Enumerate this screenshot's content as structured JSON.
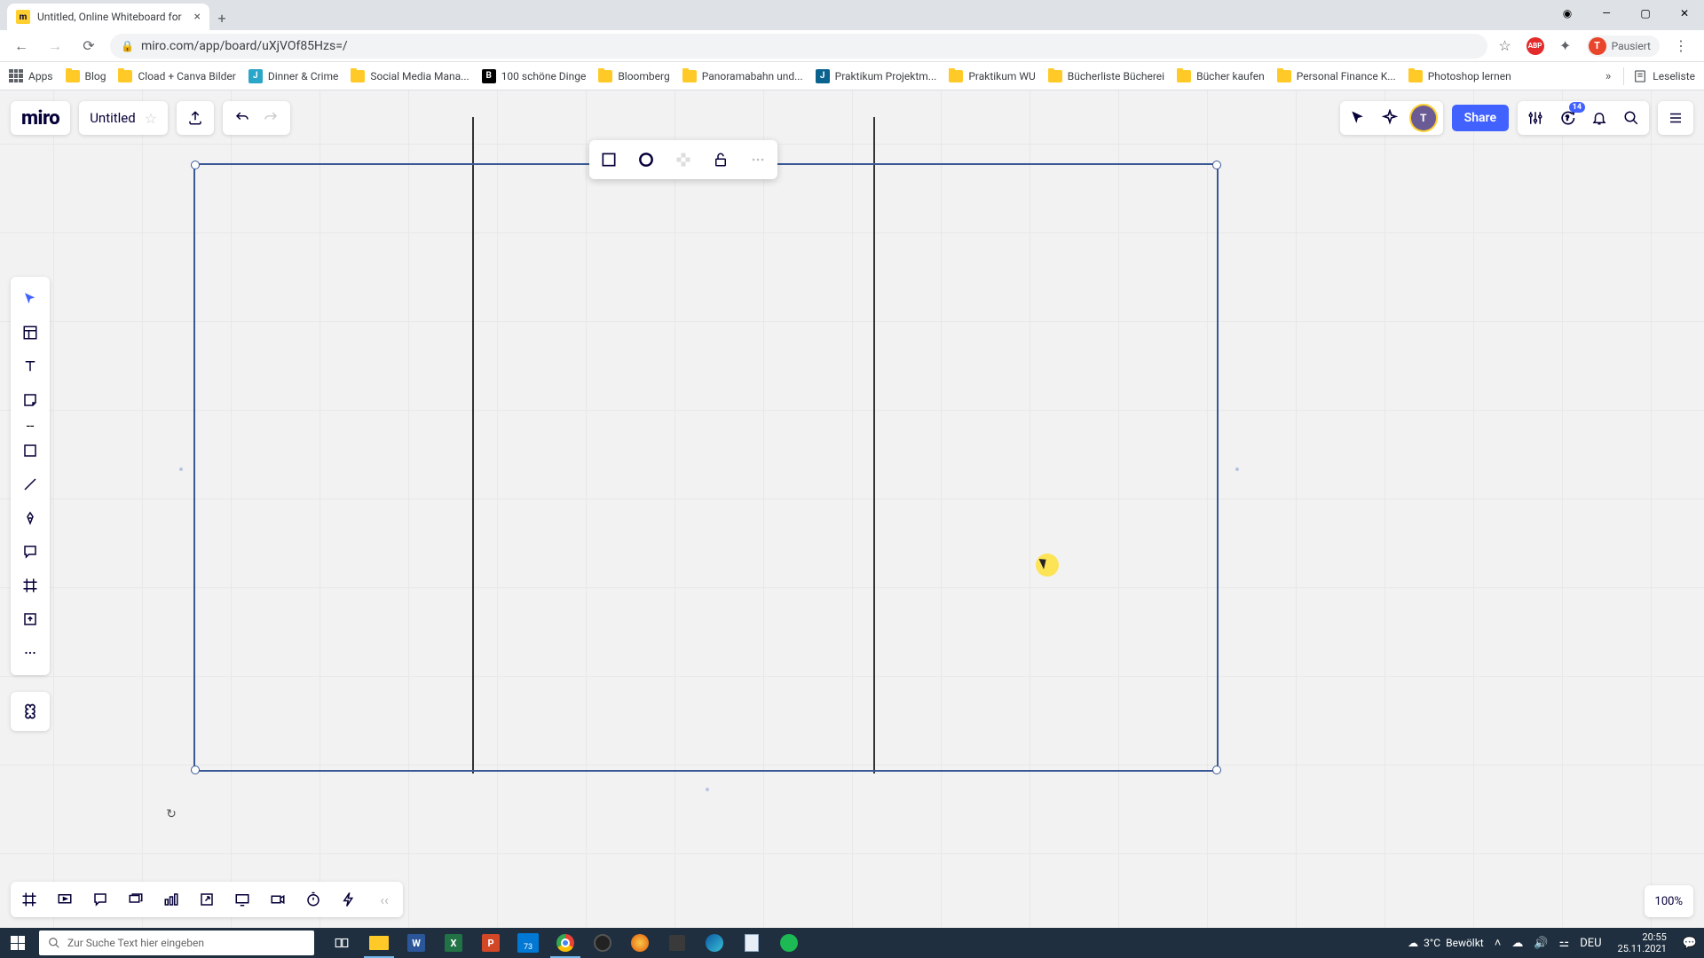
{
  "browser": {
    "tab_title": "Untitled, Online Whiteboard for",
    "url": "miro.com/app/board/uXjVOf85Hzs=/",
    "profile_label": "Pausiert",
    "profile_initial": "T"
  },
  "bookmarks": {
    "apps": "Apps",
    "items": [
      "Blog",
      "Cload + Canva Bilder",
      "Dinner & Crime",
      "Social Media Mana...",
      "100 schöne Dinge",
      "Bloomberg",
      "Panoramabahn und...",
      "Praktikum Projektm...",
      "Praktikum WU",
      "Bücherliste Bücherei",
      "Bücher kaufen",
      "Personal Finance K...",
      "Photoshop lernen"
    ],
    "reading_list": "Leseliste"
  },
  "miro": {
    "logo": "miro",
    "board_title": "Untitled",
    "share": "Share",
    "notification_count": "14",
    "avatar_initial": "T",
    "zoom": "100%"
  },
  "taskbar": {
    "search_placeholder": "Zur Suche Text hier eingeben",
    "weather_temp": "3°C",
    "weather_desc": "Bewölkt",
    "lang": "DEU",
    "time": "20:55",
    "date": "25.11.2021",
    "calendar_badge": "73"
  }
}
